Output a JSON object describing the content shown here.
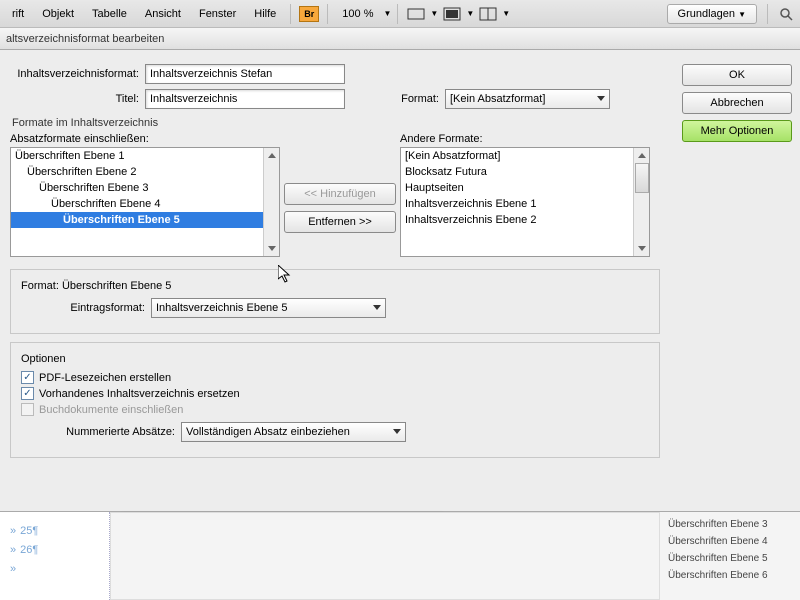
{
  "menubar": {
    "items": [
      "rift",
      "Objekt",
      "Tabelle",
      "Ansicht",
      "Fenster",
      "Hilfe"
    ],
    "br": "Br",
    "zoom": "100 %",
    "basics": "Grundlagen"
  },
  "dialog": {
    "title": "altsverzeichnisformat bearbeiten",
    "labels": {
      "toc_format": "Inhaltsverzeichnisformat:",
      "title": "Titel:",
      "format": "Format:",
      "formats_in_toc": "Formate im Inhaltsverzeichnis",
      "include_para": "Absatzformate einschließen:",
      "other_formats": "Andere Formate:",
      "format_section": "Format: Überschriften Ebene 5",
      "entry_format": "Eintragsformat:",
      "options": "Optionen",
      "numbered_para": "Nummerierte Absätze:"
    },
    "values": {
      "toc_format": "Inhaltsverzeichnis Stefan",
      "title": "Inhaltsverzeichnis",
      "format": "[Kein Absatzformat]",
      "entry_format": "Inhaltsverzeichnis Ebene 5",
      "numbered_para": "Vollständigen Absatz einbeziehen"
    },
    "include_list": [
      "Überschriften Ebene 1",
      "Überschriften Ebene 2",
      "Überschriften Ebene 3",
      "Überschriften Ebene 4",
      "Überschriften Ebene 5"
    ],
    "other_list": [
      "[Kein Absatzformat]",
      "Blocksatz Futura",
      "Hauptseiten",
      "Inhaltsverzeichnis Ebene 1",
      "Inhaltsverzeichnis Ebene 2"
    ],
    "buttons": {
      "ok": "OK",
      "cancel": "Abbrechen",
      "more": "Mehr Optionen",
      "add": "<< Hinzufügen",
      "remove": "Entfernen >>"
    },
    "checkboxes": {
      "pdf": "PDF-Lesezeichen erstellen",
      "replace": "Vorhandenes Inhaltsverzeichnis ersetzen",
      "book": "Buchdokumente einschließen"
    }
  },
  "doc": {
    "lines": [
      "25",
      "26"
    ],
    "para_marker": "¶",
    "right_panel": [
      "Überschriften Ebene 3",
      "Überschriften Ebene 4",
      "Überschriften Ebene 5",
      "Überschriften Ebene 6"
    ]
  }
}
